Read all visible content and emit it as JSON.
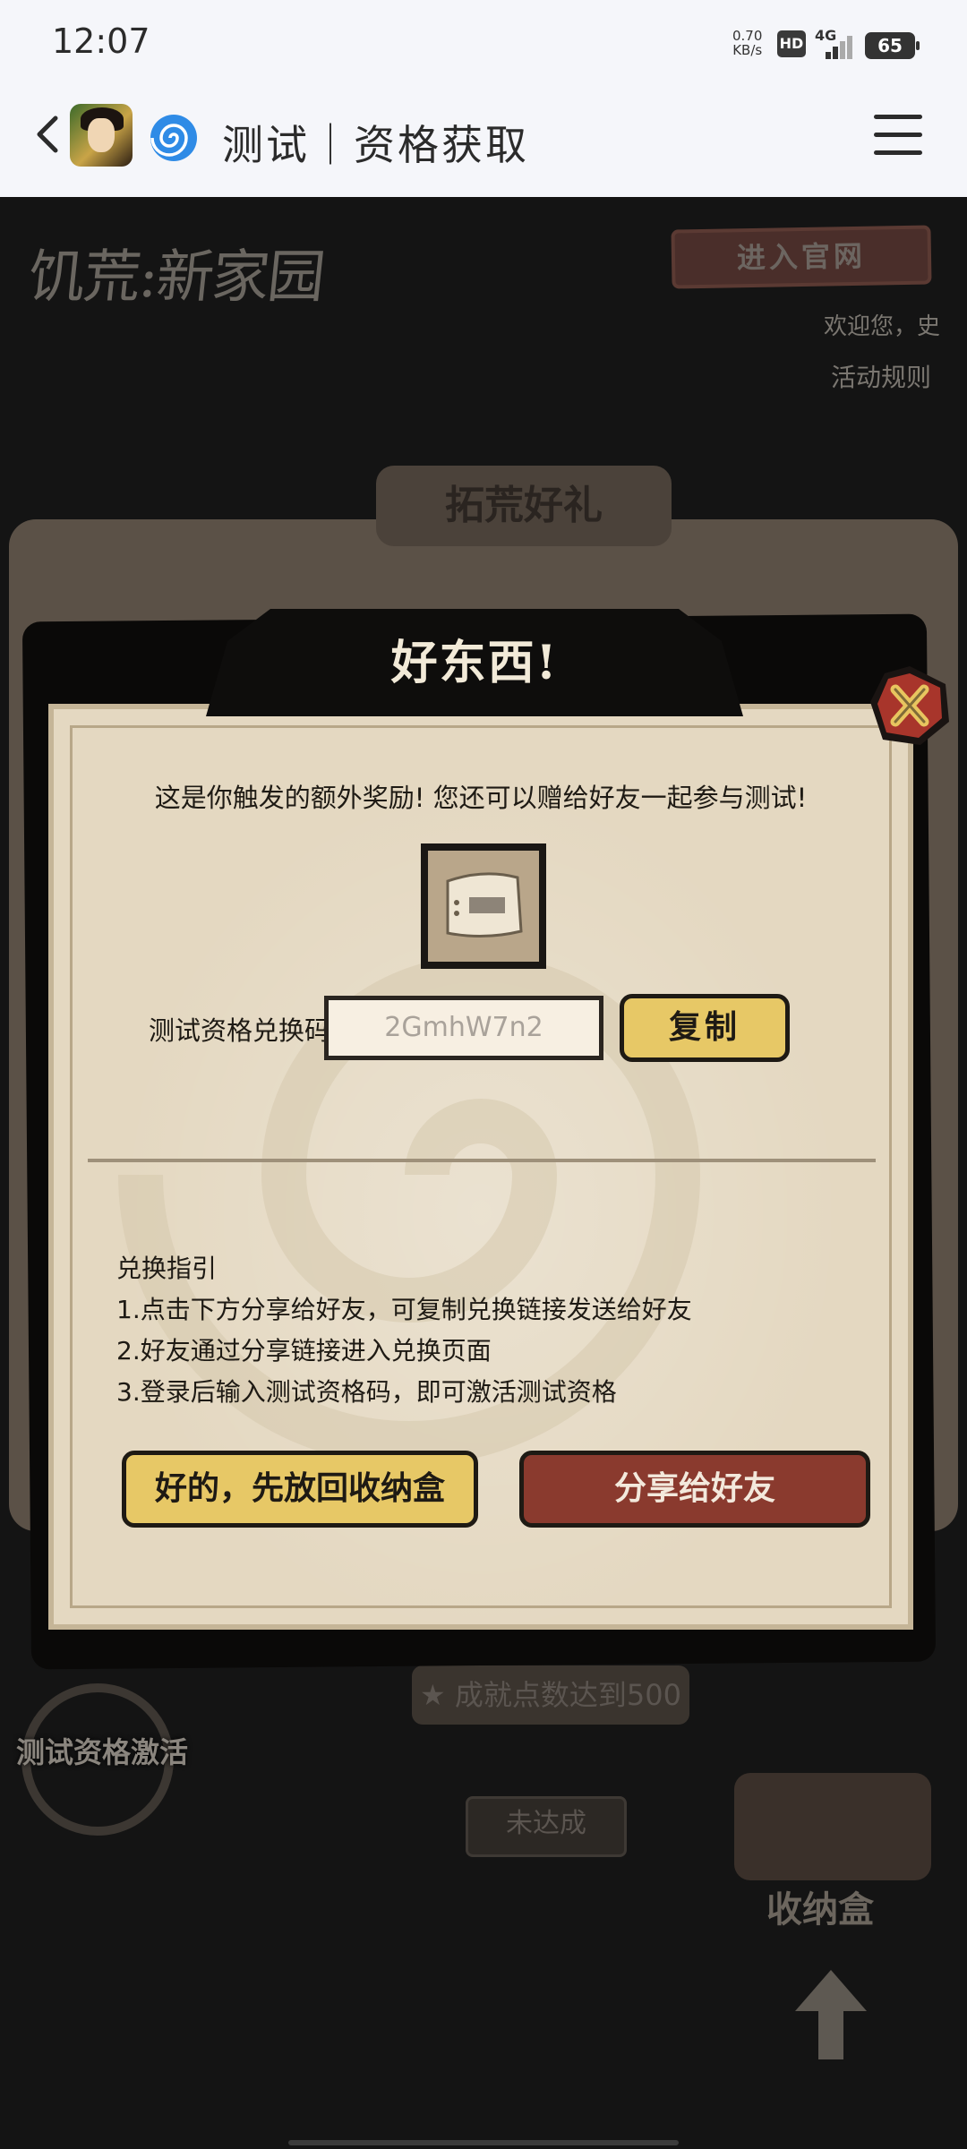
{
  "status_bar": {
    "time": "12:07",
    "net_speed_value": "0.70",
    "net_speed_unit": "KB/s",
    "hd_badge": "HD",
    "network_type": "4G",
    "battery_level": "65"
  },
  "header": {
    "title": "测试｜资格获取",
    "icons": [
      "back-icon",
      "app-icon",
      "swirl-icon",
      "menu-icon"
    ]
  },
  "page": {
    "logo_text": "饥荒:新家园",
    "official_site_button": "进入官网",
    "welcome_text": "欢迎您，史",
    "rules_link": "活动规则",
    "panel_title": "拓荒好礼",
    "achievement_pill": "★ 成就点数达到500",
    "not_done_label": "未达成",
    "activation_label": "测试资格激活",
    "storage_label": "收纳盒"
  },
  "modal": {
    "title": "好东西!",
    "intro": "这是你触发的额外奖励! 您还可以赠给好友一起参与测试!",
    "code_label": "测试资格兑换码",
    "code_value": "2GmhW7n2",
    "copy_button": "复制",
    "guide_title": "兑换指引",
    "guide_steps": [
      "1.点击下方分享给好友，可复制兑换链接发送给好友",
      "2.好友通过分享链接进入兑换页面",
      "3.登录后输入测试资格码，即可激活测试资格"
    ],
    "ok_button": "好的，先放回收纳盒",
    "share_button": "分享给好友"
  },
  "colors": {
    "paper": "#e4d8c1",
    "gold_button": "#e7c866",
    "red_button": "#8a3a2e",
    "close_red": "#a8352b",
    "overlay": "#141414"
  }
}
